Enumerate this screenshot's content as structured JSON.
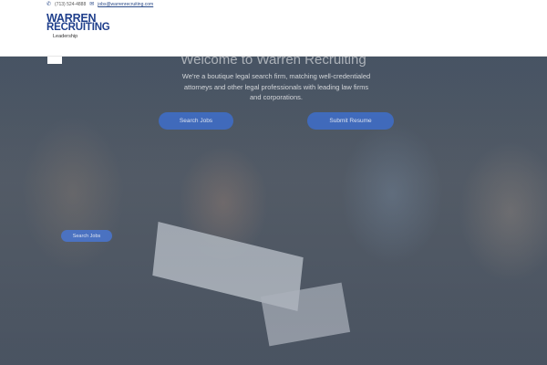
{
  "contact": {
    "phone": "(713) 524-4888",
    "email": "jobs@warrenrecruiting.com",
    "phone_icon": "phone-icon",
    "email_icon": "mail-icon"
  },
  "logo": {
    "line1": "WARREN",
    "line2": "RECRUITING",
    "line3": "Leadership"
  },
  "hero": {
    "title": "Welcome to Warren Recruiting",
    "subtitle": "We're a boutique legal search firm, matching well-credentialed attorneys and other legal professionals with leading law firms and corporations.",
    "search_button": "Search Jobs",
    "submit_button": "Submit Resume",
    "sidebar_search_button": "Search Jobs"
  },
  "colors": {
    "brand": "#1f3f8c",
    "button": "#3f6cc3"
  }
}
